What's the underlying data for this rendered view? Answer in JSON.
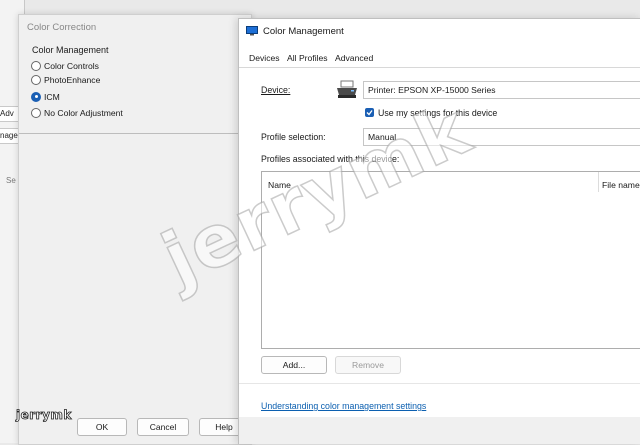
{
  "background_window": {
    "buttons": [
      "Adv",
      "nage"
    ],
    "text": "Se"
  },
  "color_correction": {
    "title": "Color Correction",
    "group_label": "Color Management",
    "options": [
      {
        "label": "Color Controls",
        "selected": false
      },
      {
        "label": "PhotoEnhance",
        "selected": false
      },
      {
        "label": "ICM",
        "selected": true
      },
      {
        "label": "No Color Adjustment",
        "selected": false
      }
    ],
    "ok_label": "OK",
    "cancel_label": "Cancel",
    "help_label": "Help"
  },
  "color_management": {
    "title": "Color Management",
    "tabs": [
      "Devices",
      "All Profiles",
      "Advanced"
    ],
    "active_tab": "Devices",
    "device_label": "Device:",
    "device_value": "Printer: EPSON XP-15000 Series",
    "use_settings_label": "Use my settings for this device",
    "use_settings_checked": true,
    "profile_selection_label": "Profile selection:",
    "profile_selection_value": "Manual",
    "profiles_associated_label": "Profiles associated with this device:",
    "columns": [
      "Name",
      "File name"
    ],
    "add_label": "Add...",
    "remove_label": "Remove",
    "link_text": "Understanding color management settings",
    "accent_color": "#1a5fb4"
  },
  "watermark": {
    "main": "jerrymk",
    "corner": "jerrymk"
  }
}
